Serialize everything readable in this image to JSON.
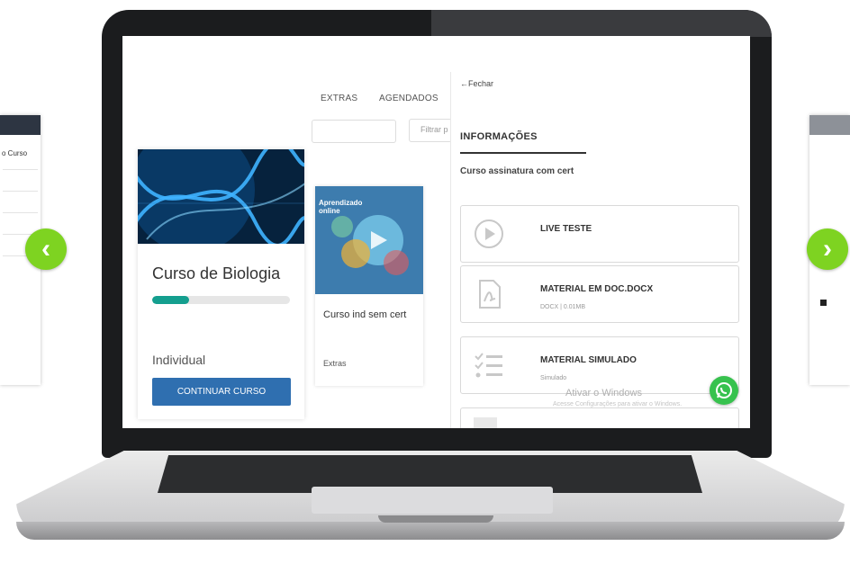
{
  "carousel": {
    "left_preview_text": "o Curso",
    "prev_icon": "chevron-left-icon",
    "next_icon": "chevron-right-icon",
    "accent_color": "#7ed321"
  },
  "tabs": [
    "EXTRAS",
    "AGENDADOS"
  ],
  "filter": {
    "placeholder": "Filtrar p"
  },
  "courses": [
    {
      "title": "Curso de Biologia",
      "progress": 0.27,
      "type": "Individual",
      "button": "CONTINUAR CURSO"
    },
    {
      "badge": "Aprendizado online",
      "title": "Curso ind sem cert",
      "category": "Extras"
    }
  ],
  "panel": {
    "close": "Fechar",
    "heading": "INFORMAÇÕES",
    "subtitle": "Curso assinatura com cert",
    "items": [
      {
        "title": "LIVE TESTE",
        "sub": "",
        "icon": "play-icon"
      },
      {
        "title": "MATERIAL EM DOC.DOCX",
        "sub": "DOCX | 0.01MB",
        "icon": "pdf-file-icon"
      },
      {
        "title": "MATERIAL SIMULADO",
        "sub": "Simulado",
        "icon": "checklist-icon"
      }
    ]
  },
  "watermark": {
    "title": "Ativar o Windows",
    "sub": "Acesse Configurações para ativar o Windows."
  },
  "colors": {
    "primary_button": "#2f6fb0",
    "progress": "#149f8f",
    "whatsapp": "#37c24e"
  }
}
